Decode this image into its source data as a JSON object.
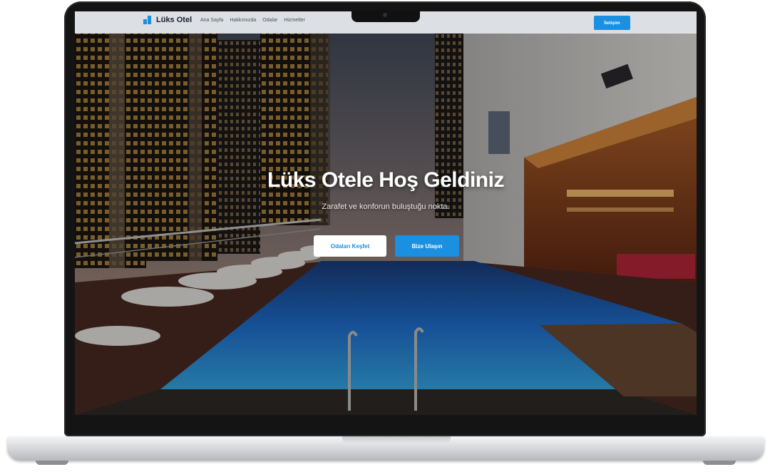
{
  "navbar": {
    "brand": "Lüks Otel",
    "links": [
      "Ana Sayfa",
      "Hakkımızda",
      "Odalar",
      "Hizmetler"
    ],
    "contact_button": "İletişim"
  },
  "hero": {
    "title": "Lüks Otele Hoş Geldiniz",
    "subtitle": "Zarafet ve konforun buluştuğu nokta.",
    "explore_button": "Odaları Keşfet",
    "contact_button": "Bize Ulaşın"
  },
  "colors": {
    "accent": "#1b8fe0",
    "navbar_bg": "#e8eaee",
    "laptop_bezel": "#141414"
  }
}
